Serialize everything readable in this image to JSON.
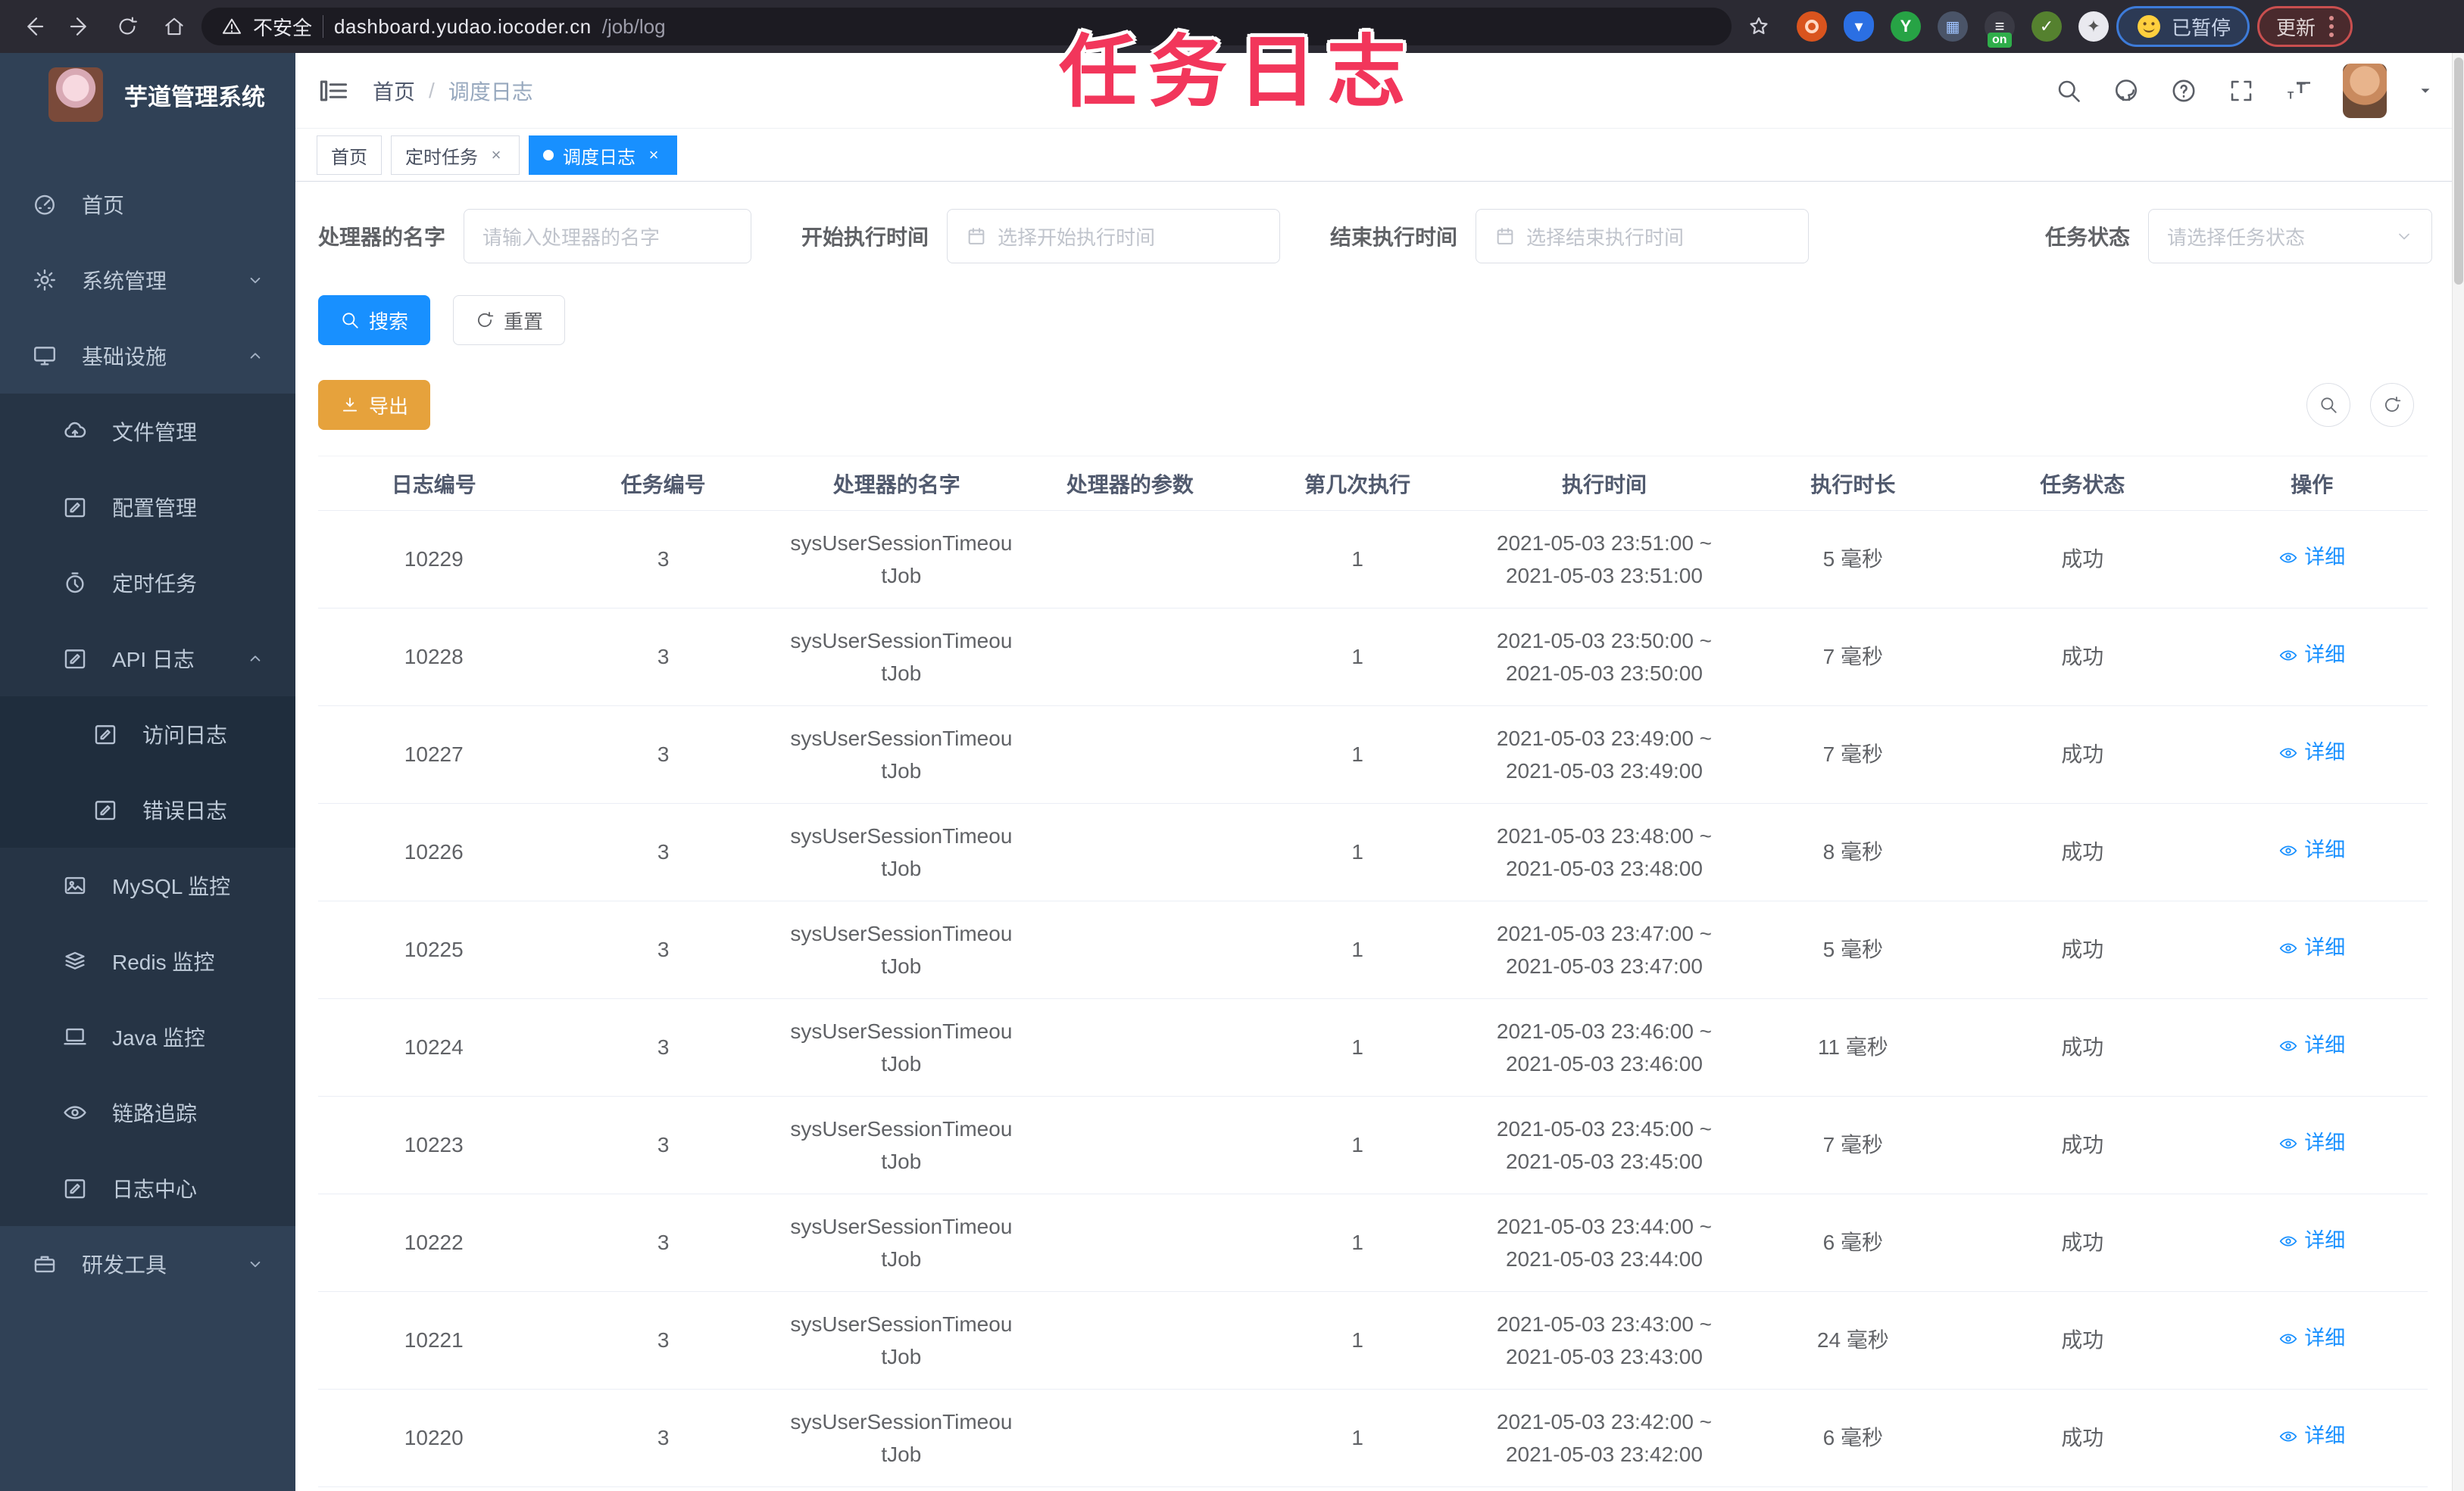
{
  "browser": {
    "security_label": "不安全",
    "url_domain": "dashboard.yudao.iocoder.cn",
    "url_path": "/job/log",
    "paused_badge": "已暂停",
    "update_button": "更新",
    "extensions": [
      "bookmark-star",
      "orange-extension",
      "blue-pin-extension",
      "green-check-extension",
      "grid-extension",
      "on-switch-extension",
      "green-leaf-extension",
      "puzzle-extension"
    ]
  },
  "overlay": {
    "title": "任务日志"
  },
  "sidebar": {
    "app_title": "芋道管理系统",
    "items": [
      {
        "name": "sidebar-item-home",
        "icon": "gauge",
        "label": "首页",
        "level": 1,
        "arrow": ""
      },
      {
        "name": "sidebar-item-system-mgmt",
        "icon": "gear",
        "label": "系统管理",
        "level": 1,
        "arrow": "down"
      },
      {
        "name": "sidebar-item-infrastructure",
        "icon": "monitor",
        "label": "基础设施",
        "level": 1,
        "arrow": "up"
      },
      {
        "name": "sidebar-item-file-mgmt",
        "icon": "cloud",
        "label": "文件管理",
        "level": 2,
        "arrow": ""
      },
      {
        "name": "sidebar-item-config-mgmt",
        "icon": "edit",
        "label": "配置管理",
        "level": 2,
        "arrow": ""
      },
      {
        "name": "sidebar-item-timed-task",
        "icon": "timer",
        "label": "定时任务",
        "level": 2,
        "arrow": ""
      },
      {
        "name": "sidebar-item-api-log",
        "icon": "edit",
        "label": "API 日志",
        "level": 2,
        "arrow": "up"
      },
      {
        "name": "sidebar-item-access-log",
        "icon": "edit",
        "label": "访问日志",
        "level": 3,
        "arrow": ""
      },
      {
        "name": "sidebar-item-error-log",
        "icon": "edit",
        "label": "错误日志",
        "level": 3,
        "arrow": ""
      },
      {
        "name": "sidebar-item-mysql-monitor",
        "icon": "image",
        "label": "MySQL 监控",
        "level": 2,
        "arrow": ""
      },
      {
        "name": "sidebar-item-redis-monitor",
        "icon": "layers",
        "label": "Redis 监控",
        "level": 2,
        "arrow": ""
      },
      {
        "name": "sidebar-item-java-monitor",
        "icon": "laptop",
        "label": "Java 监控",
        "level": 2,
        "arrow": ""
      },
      {
        "name": "sidebar-item-trace",
        "icon": "eye",
        "label": "链路追踪",
        "level": 2,
        "arrow": ""
      },
      {
        "name": "sidebar-item-log-center",
        "icon": "edit",
        "label": "日志中心",
        "level": 2,
        "arrow": ""
      },
      {
        "name": "sidebar-item-dev-tools",
        "icon": "tool",
        "label": "研发工具",
        "level": 1,
        "arrow": "down"
      }
    ]
  },
  "header": {
    "breadcrumb_home": "首页",
    "breadcrumb_separator": "/",
    "breadcrumb_current": "调度日志"
  },
  "tabs": [
    {
      "name": "tab-home",
      "label": "首页",
      "closable": false,
      "active": false
    },
    {
      "name": "tab-timed-task",
      "label": "定时任务",
      "closable": true,
      "active": false
    },
    {
      "name": "tab-job-log",
      "label": "调度日志",
      "closable": true,
      "active": true
    }
  ],
  "filters": {
    "handler_name": {
      "label": "处理器的名字",
      "placeholder": "请输入处理器的名字"
    },
    "begin_time": {
      "label": "开始执行时间",
      "placeholder": "选择开始执行时间"
    },
    "end_time": {
      "label": "结束执行时间",
      "placeholder": "选择结束执行时间"
    },
    "status": {
      "label": "任务状态",
      "placeholder": "请选择任务状态"
    },
    "search_label": "搜索",
    "reset_label": "重置"
  },
  "toolbar": {
    "export_label": "导出"
  },
  "table": {
    "columns": [
      "日志编号",
      "任务编号",
      "处理器的名字",
      "处理器的参数",
      "第几次执行",
      "执行时间",
      "执行时长",
      "任务状态",
      "操作"
    ],
    "detail_label": "详细",
    "rows": [
      {
        "id": "10229",
        "job_id": "3",
        "handler": "sysUserSessionTimeoutJob",
        "param": "",
        "index": "1",
        "time_start": "2021-05-03 23:51:00",
        "time_end": "2021-05-03 23:51:00",
        "duration": "5 毫秒",
        "status": "成功"
      },
      {
        "id": "10228",
        "job_id": "3",
        "handler": "sysUserSessionTimeoutJob",
        "param": "",
        "index": "1",
        "time_start": "2021-05-03 23:50:00",
        "time_end": "2021-05-03 23:50:00",
        "duration": "7 毫秒",
        "status": "成功"
      },
      {
        "id": "10227",
        "job_id": "3",
        "handler": "sysUserSessionTimeoutJob",
        "param": "",
        "index": "1",
        "time_start": "2021-05-03 23:49:00",
        "time_end": "2021-05-03 23:49:00",
        "duration": "7 毫秒",
        "status": "成功"
      },
      {
        "id": "10226",
        "job_id": "3",
        "handler": "sysUserSessionTimeoutJob",
        "param": "",
        "index": "1",
        "time_start": "2021-05-03 23:48:00",
        "time_end": "2021-05-03 23:48:00",
        "duration": "8 毫秒",
        "status": "成功"
      },
      {
        "id": "10225",
        "job_id": "3",
        "handler": "sysUserSessionTimeoutJob",
        "param": "",
        "index": "1",
        "time_start": "2021-05-03 23:47:00",
        "time_end": "2021-05-03 23:47:00",
        "duration": "5 毫秒",
        "status": "成功"
      },
      {
        "id": "10224",
        "job_id": "3",
        "handler": "sysUserSessionTimeoutJob",
        "param": "",
        "index": "1",
        "time_start": "2021-05-03 23:46:00",
        "time_end": "2021-05-03 23:46:00",
        "duration": "11 毫秒",
        "status": "成功"
      },
      {
        "id": "10223",
        "job_id": "3",
        "handler": "sysUserSessionTimeoutJob",
        "param": "",
        "index": "1",
        "time_start": "2021-05-03 23:45:00",
        "time_end": "2021-05-03 23:45:00",
        "duration": "7 毫秒",
        "status": "成功"
      },
      {
        "id": "10222",
        "job_id": "3",
        "handler": "sysUserSessionTimeoutJob",
        "param": "",
        "index": "1",
        "time_start": "2021-05-03 23:44:00",
        "time_end": "2021-05-03 23:44:00",
        "duration": "6 毫秒",
        "status": "成功"
      },
      {
        "id": "10221",
        "job_id": "3",
        "handler": "sysUserSessionTimeoutJob",
        "param": "",
        "index": "1",
        "time_start": "2021-05-03 23:43:00",
        "time_end": "2021-05-03 23:43:00",
        "duration": "24 毫秒",
        "status": "成功"
      },
      {
        "id": "10220",
        "job_id": "3",
        "handler": "sysUserSessionTimeoutJob",
        "param": "",
        "index": "1",
        "time_start": "2021-05-03 23:42:00",
        "time_end": "2021-05-03 23:42:00",
        "duration": "6 毫秒",
        "status": "成功"
      }
    ]
  }
}
